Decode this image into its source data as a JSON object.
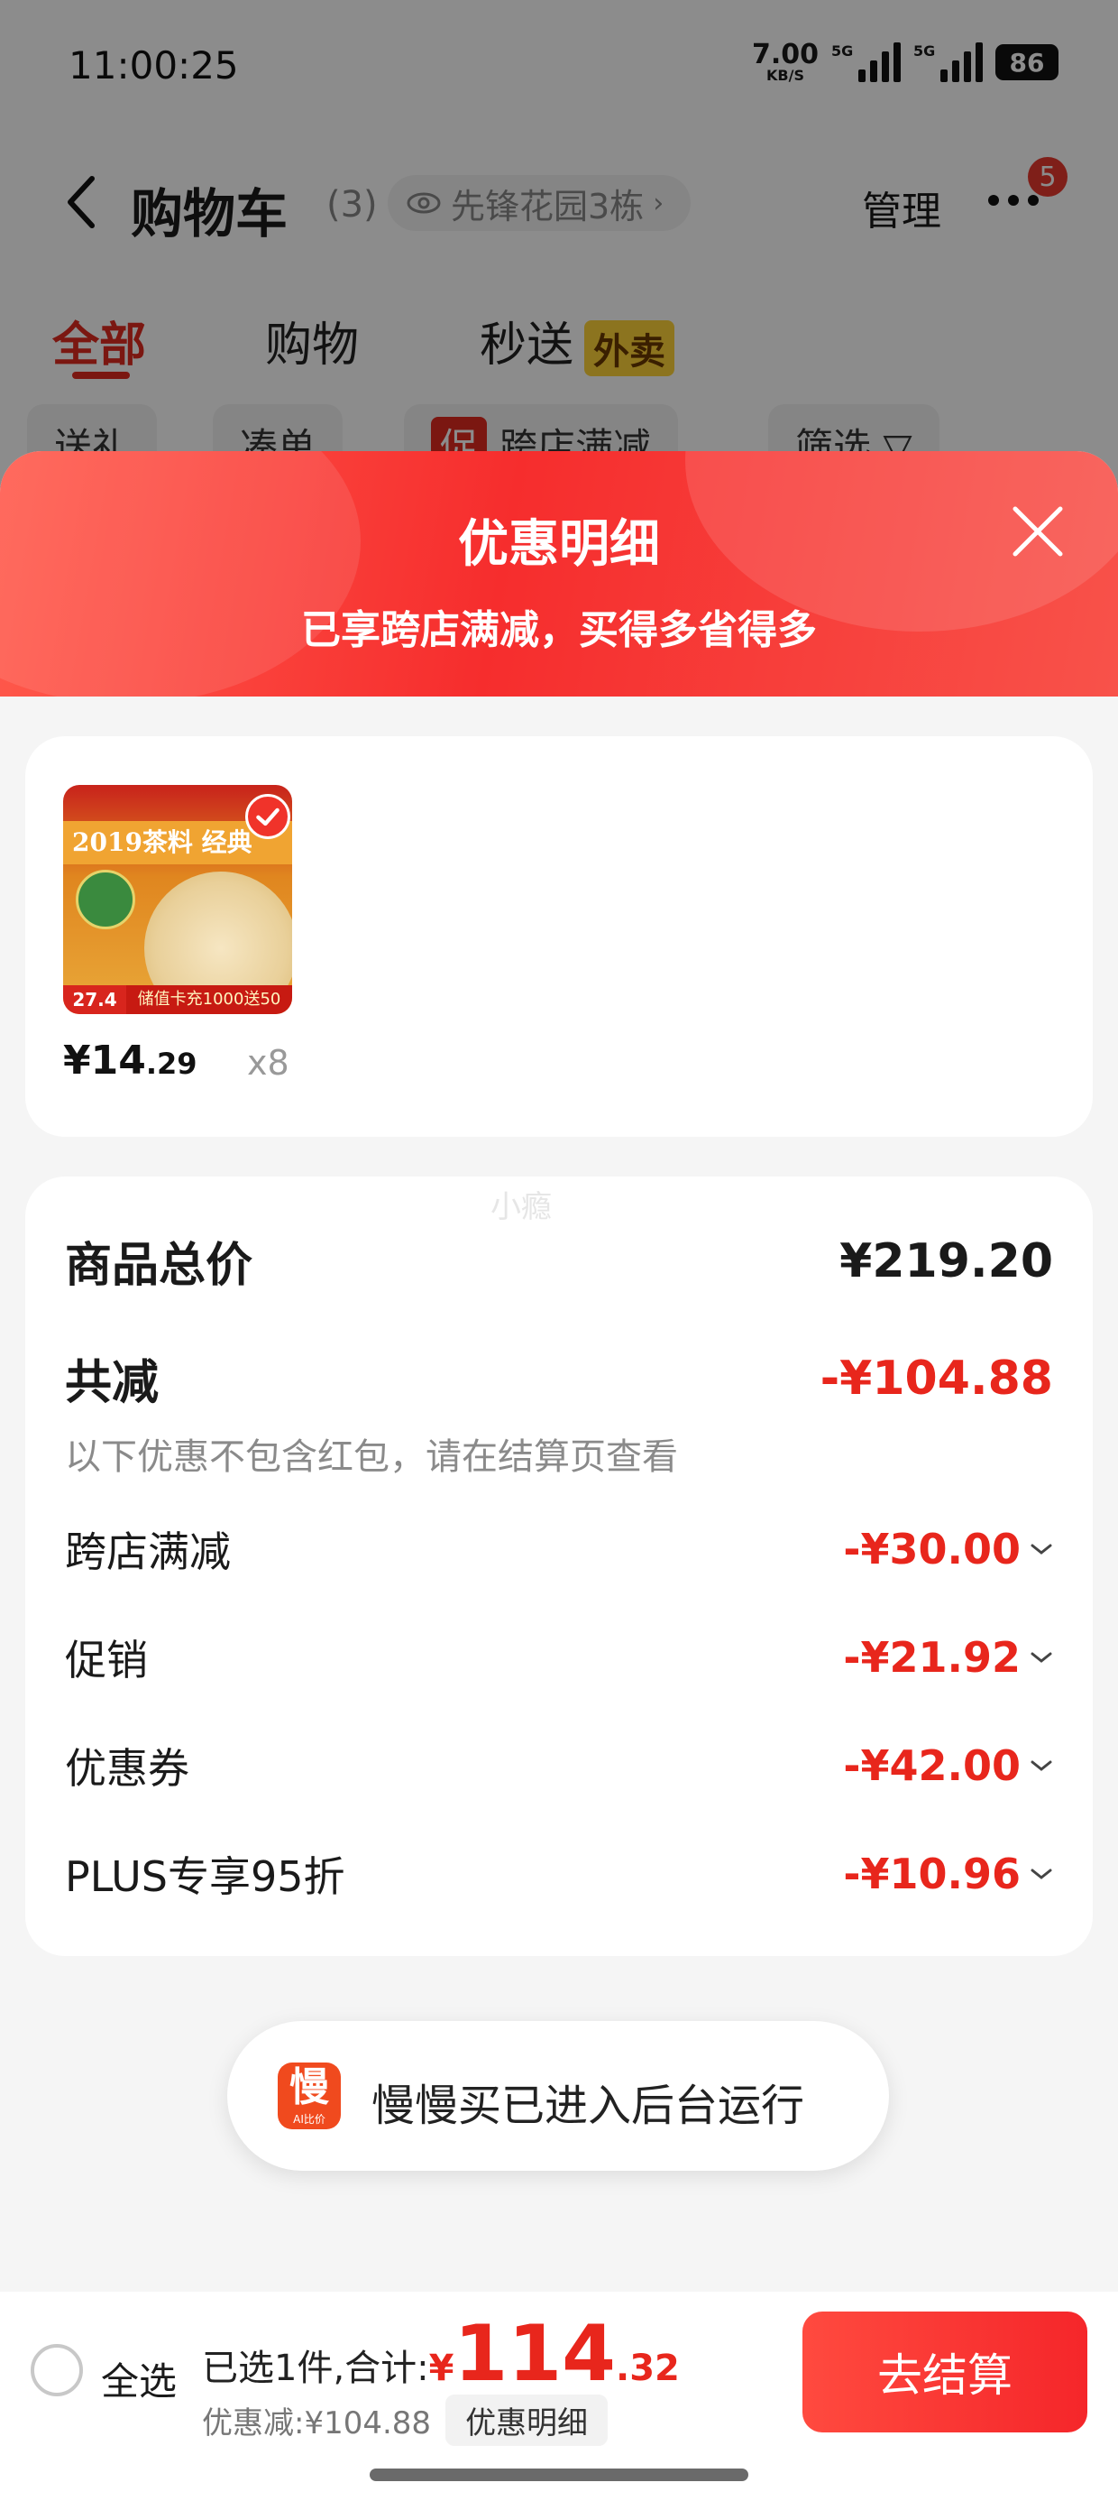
{
  "status": {
    "time": "11:00:25",
    "net_speed": "7.00",
    "net_unit": "KB/S",
    "signal1_tag": "5G",
    "signal2_tag": "5G",
    "battery": "86"
  },
  "nav": {
    "title": "购物车",
    "count": "(3)",
    "location": "先锋花园3栋",
    "manage": "管理",
    "more_badge": "5"
  },
  "tabs": [
    {
      "label": "全部"
    },
    {
      "label": "购物"
    },
    {
      "label": "秒送",
      "tag": "外卖"
    }
  ],
  "filters": [
    {
      "label": "送礼"
    },
    {
      "label": "凑单"
    },
    {
      "label": "跨店满减",
      "prefix": "促"
    },
    {
      "label": "筛选 ▽"
    }
  ],
  "sheet": {
    "title": "优惠明细",
    "subtitle": "已享跨店满减，买得多省得多",
    "product": {
      "image_banner": "2019茶料 经典",
      "image_price": "27.4",
      "image_promo": "储值卡充1000送50",
      "price_main": "¥14",
      "price_decimal": ".29",
      "quantity": "x8"
    },
    "watermark": "小瘾",
    "total_label": "商品总价",
    "total_amount": "¥219.20",
    "discount_label": "共减",
    "discount_amount": "-¥104.88",
    "note": "以下优惠不包含红包，请在结算页查看",
    "items": [
      {
        "label": "跨店满减",
        "amount": "-¥30.00"
      },
      {
        "label": "促销",
        "amount": "-¥21.92"
      },
      {
        "label": "优惠券",
        "amount": "-¥42.00"
      },
      {
        "label": "PLUS专享95折",
        "amount": "-¥10.96"
      }
    ]
  },
  "toast": {
    "icon_glyph": "慢",
    "icon_sub": "AI比价",
    "text": "慢慢买已进入后台运行"
  },
  "bottom": {
    "select_all": "全选",
    "selected_text": "已选1件,合计:",
    "currency": "¥",
    "total_int": "114",
    "total_dec": ".32",
    "discount_text": "优惠减:¥104.88",
    "detail_button": "优惠明细",
    "checkout": "去结算"
  },
  "colors": {
    "accent": "#e8261c",
    "header_gradient_start": "#ff5a4c",
    "header_gradient_end": "#f62d2d"
  }
}
